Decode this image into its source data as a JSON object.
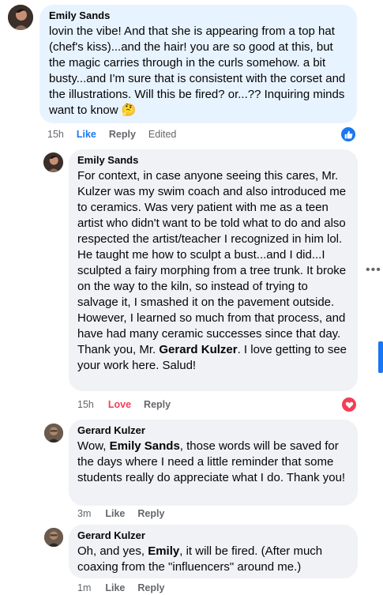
{
  "comments": [
    {
      "author": "Emily Sands",
      "text": "lovin the vibe! And that she is appearing from a top hat (chef's kiss)...and the hair! you are so good at this, but the magic carries through in the curls somehow. a bit busty...and I'm sure that is consistent with the corset and the illustrations. Will this be fired? or...?? Inquiring minds want to know 🤔",
      "time": "15h",
      "like": "Like",
      "reply": "Reply",
      "edited": "Edited",
      "reaction": "like-icon"
    },
    {
      "author": "Emily Sands",
      "text_before": "For context, in case anyone seeing this cares, Mr. Kulzer was my swim coach and also introduced me to ceramics. Was very patient with me as a teen artist who didn't want to be told what to do and also respected the artist/teacher I recognized in him lol. He taught me how to sculpt a bust...and I did...I sculpted a fairy morphing from a tree trunk. It broke on the way to the kiln, so instead of trying to salvage it, I smashed it on the pavement outside. However, I learned so much from that process, and have had many ceramic successes since that day. Thank you, Mr. ",
      "mention": "Gerard Kulzer",
      "text_after": ". I love getting to see your work here. Salud!",
      "time": "15h",
      "love": "Love",
      "reply": "Reply",
      "reaction": "heart-icon"
    },
    {
      "author": "Gerard Kulzer",
      "text_before": "Wow, ",
      "mention": "Emily Sands",
      "text_after": ", those words will be saved for the days where I need a little reminder that some students really do appreciate what I do. Thank you!",
      "time": "3m",
      "like": "Like",
      "reply": "Reply"
    },
    {
      "author": "Gerard Kulzer",
      "text_before": "Oh, and yes, ",
      "mention": "Emily",
      "text_after": ", it will be fired. (After much coaxing from the \"influencers\" around me.)",
      "time": "1m",
      "like": "Like",
      "reply": "Reply"
    }
  ],
  "more_menu": "•••",
  "colors": {
    "bubble": "#f0f2f5",
    "bubble_highlight": "#e7f3ff",
    "like_blue": "#1877f2",
    "love_red": "#f33e58",
    "meta_gray": "#65676b"
  }
}
